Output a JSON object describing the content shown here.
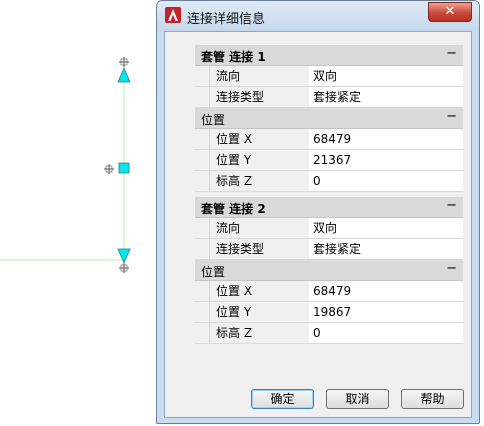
{
  "dialog": {
    "title": "连接详细信息",
    "close_label": "✕",
    "groups": [
      {
        "title": "套管 连接 1",
        "collapse": "−",
        "rows": [
          {
            "name": "流向",
            "value": "双向"
          },
          {
            "name": "连接类型",
            "value": "套接紧定"
          }
        ],
        "subgroup": {
          "title": "位置",
          "collapse": "−",
          "rows": [
            {
              "name": "位置 X",
              "value": "68479"
            },
            {
              "name": "位置 Y",
              "value": "21367"
            },
            {
              "name": "标高 Z",
              "value": "0"
            }
          ]
        }
      },
      {
        "title": "套管 连接 2",
        "collapse": "−",
        "rows": [
          {
            "name": "流向",
            "value": "双向"
          },
          {
            "name": "连接类型",
            "value": "套接紧定"
          }
        ],
        "subgroup": {
          "title": "位置",
          "collapse": "−",
          "rows": [
            {
              "name": "位置 X",
              "value": "68479"
            },
            {
              "name": "位置 Y",
              "value": "19867"
            },
            {
              "name": "标高 Z",
              "value": "0"
            }
          ]
        }
      }
    ],
    "buttons": {
      "ok": "确定",
      "cancel": "取消",
      "help": "帮助"
    }
  },
  "colors": {
    "grip": "#00e5ee",
    "line": "#b8f0a0"
  }
}
